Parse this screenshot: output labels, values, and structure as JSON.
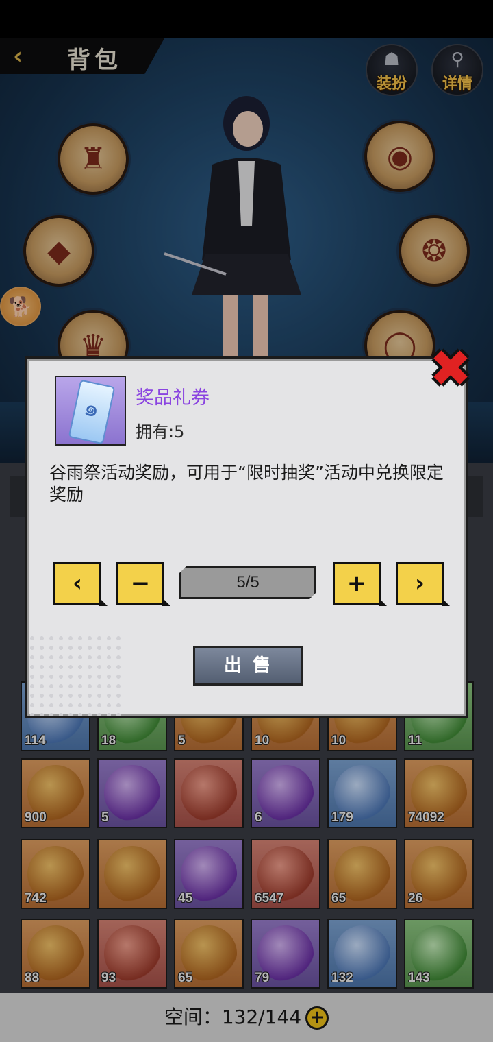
{
  "header": {
    "title": "背包",
    "buttons": [
      {
        "label": "装扮"
      },
      {
        "label": "详情"
      }
    ]
  },
  "bag": {
    "rows": [
      [
        {
          "count": "114",
          "quality": "blue"
        },
        {
          "count": "18",
          "quality": "green"
        },
        {
          "count": "5",
          "quality": "orange"
        },
        {
          "count": "10",
          "quality": "orange"
        },
        {
          "count": "10",
          "quality": "orange"
        },
        {
          "count": "11",
          "quality": "green"
        }
      ],
      [
        {
          "count": "900",
          "quality": "orange"
        },
        {
          "count": "5",
          "quality": "purple"
        },
        {
          "count": "",
          "quality": "red"
        },
        {
          "count": "6",
          "quality": "purple"
        },
        {
          "count": "179",
          "quality": "blue"
        },
        {
          "count": "74092",
          "quality": "orange"
        }
      ],
      [
        {
          "count": "742",
          "quality": "orange"
        },
        {
          "count": "",
          "quality": "orange"
        },
        {
          "count": "45",
          "quality": "purple"
        },
        {
          "count": "6547",
          "quality": "red"
        },
        {
          "count": "65",
          "quality": "orange"
        },
        {
          "count": "26",
          "quality": "orange"
        }
      ],
      [
        {
          "count": "88",
          "quality": "orange"
        },
        {
          "count": "93",
          "quality": "red"
        },
        {
          "count": "65",
          "quality": "orange"
        },
        {
          "count": "79",
          "quality": "purple"
        },
        {
          "count": "132",
          "quality": "blue"
        },
        {
          "count": "143",
          "quality": "green"
        }
      ]
    ],
    "space_label": "空间：",
    "space_value": "132/144"
  },
  "modal": {
    "item_name": "奖品礼券",
    "owned": "拥有:5",
    "description": "谷雨祭活动奖励，可用于“限时抽奖”活动中兑换限定奖励",
    "quantity": "5/5",
    "sell_label": "出售"
  }
}
